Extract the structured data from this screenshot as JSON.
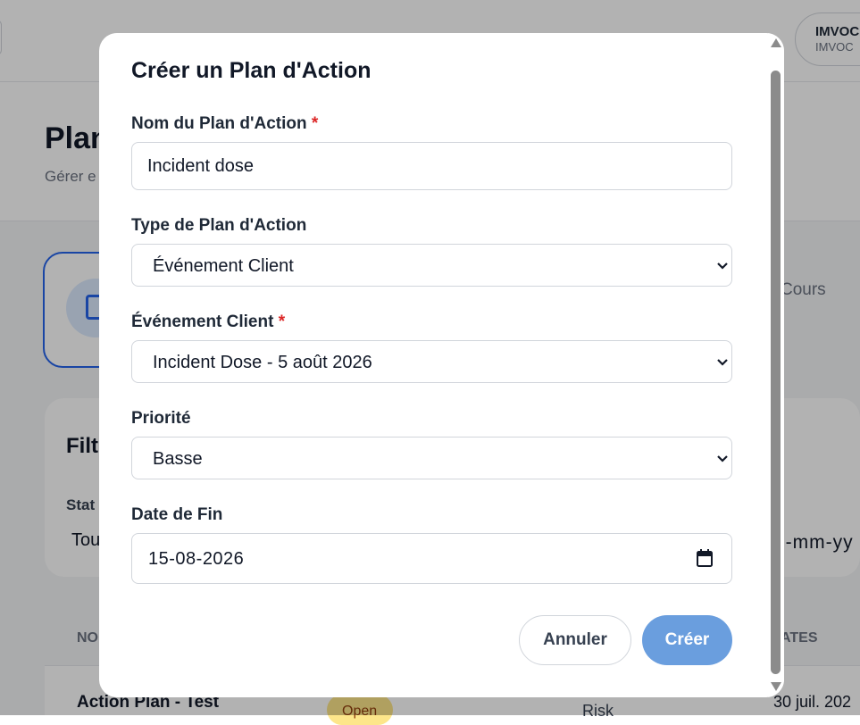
{
  "background": {
    "user": {
      "name": "IMVOC",
      "subtitle": "IMVOC"
    },
    "page_title": "Plan",
    "page_subtitle": "Gérer e",
    "stat_label": "Cours",
    "filters": {
      "title": "Filt",
      "status_label": "Stat",
      "status_value": "Tou",
      "date_placeholder": "l-mm-yy"
    },
    "table": {
      "header_left": "NO",
      "header_right": "ATES",
      "row": {
        "name": "Action Plan - Test",
        "status": "Open",
        "type": "Risk",
        "date": "30 juil. 202"
      }
    }
  },
  "modal": {
    "title": "Créer un Plan d'Action",
    "required_marker": "*",
    "name_field": {
      "label": "Nom du Plan d'Action",
      "value": "Incident dose"
    },
    "type_field": {
      "label": "Type de Plan d'Action",
      "value": "Événement Client"
    },
    "event_field": {
      "label": "Événement Client",
      "value": "Incident Dose - 5 août 2026"
    },
    "priority_field": {
      "label": "Priorité",
      "value": "Basse"
    },
    "end_date_field": {
      "label": "Date de Fin",
      "value": "15-08-2026"
    },
    "buttons": {
      "cancel": "Annuler",
      "create": "Créer"
    }
  },
  "colors": {
    "primary_button": "#6a9ede",
    "required": "#dc2626",
    "overlay": "rgba(0,0,0,0.30)",
    "active_card_border": "#2563eb"
  },
  "icons": {
    "select": "chevron-down-icon",
    "date": "calendar-icon",
    "stat": "clipboard-icon"
  }
}
